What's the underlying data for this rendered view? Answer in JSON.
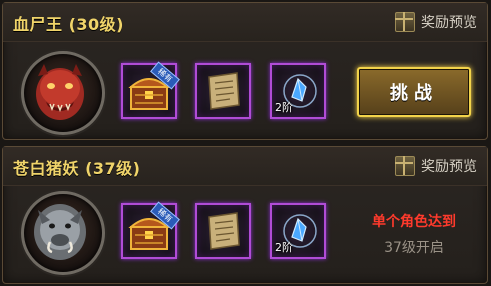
{
  "bosses": [
    {
      "title": "血尸王 (30级)",
      "preview_label": "奖励预览",
      "portrait_icon": "red-zombie-king-portrait",
      "rewards": [
        {
          "icon": "treasure-chest-icon",
          "tag": "稀有"
        },
        {
          "icon": "scroll-icon"
        },
        {
          "icon": "blue-crystal-icon",
          "tier": "2阶"
        }
      ],
      "action_label": "挑战"
    },
    {
      "title": "苍白猪妖 (37级)",
      "preview_label": "奖励预览",
      "portrait_icon": "pale-boar-demon-portrait",
      "rewards": [
        {
          "icon": "treasure-chest-icon",
          "tag": "稀有"
        },
        {
          "icon": "scroll-icon"
        },
        {
          "icon": "blue-crystal-icon",
          "tier": "2阶"
        }
      ],
      "lock_line1": "单个角色达到",
      "lock_line2": "37级开启"
    }
  ],
  "colors": {
    "title": "#f0d46a",
    "slot_border": "#b04cd6",
    "challenge_border": "#f2d34a",
    "lock_red": "#ff3a2c"
  }
}
